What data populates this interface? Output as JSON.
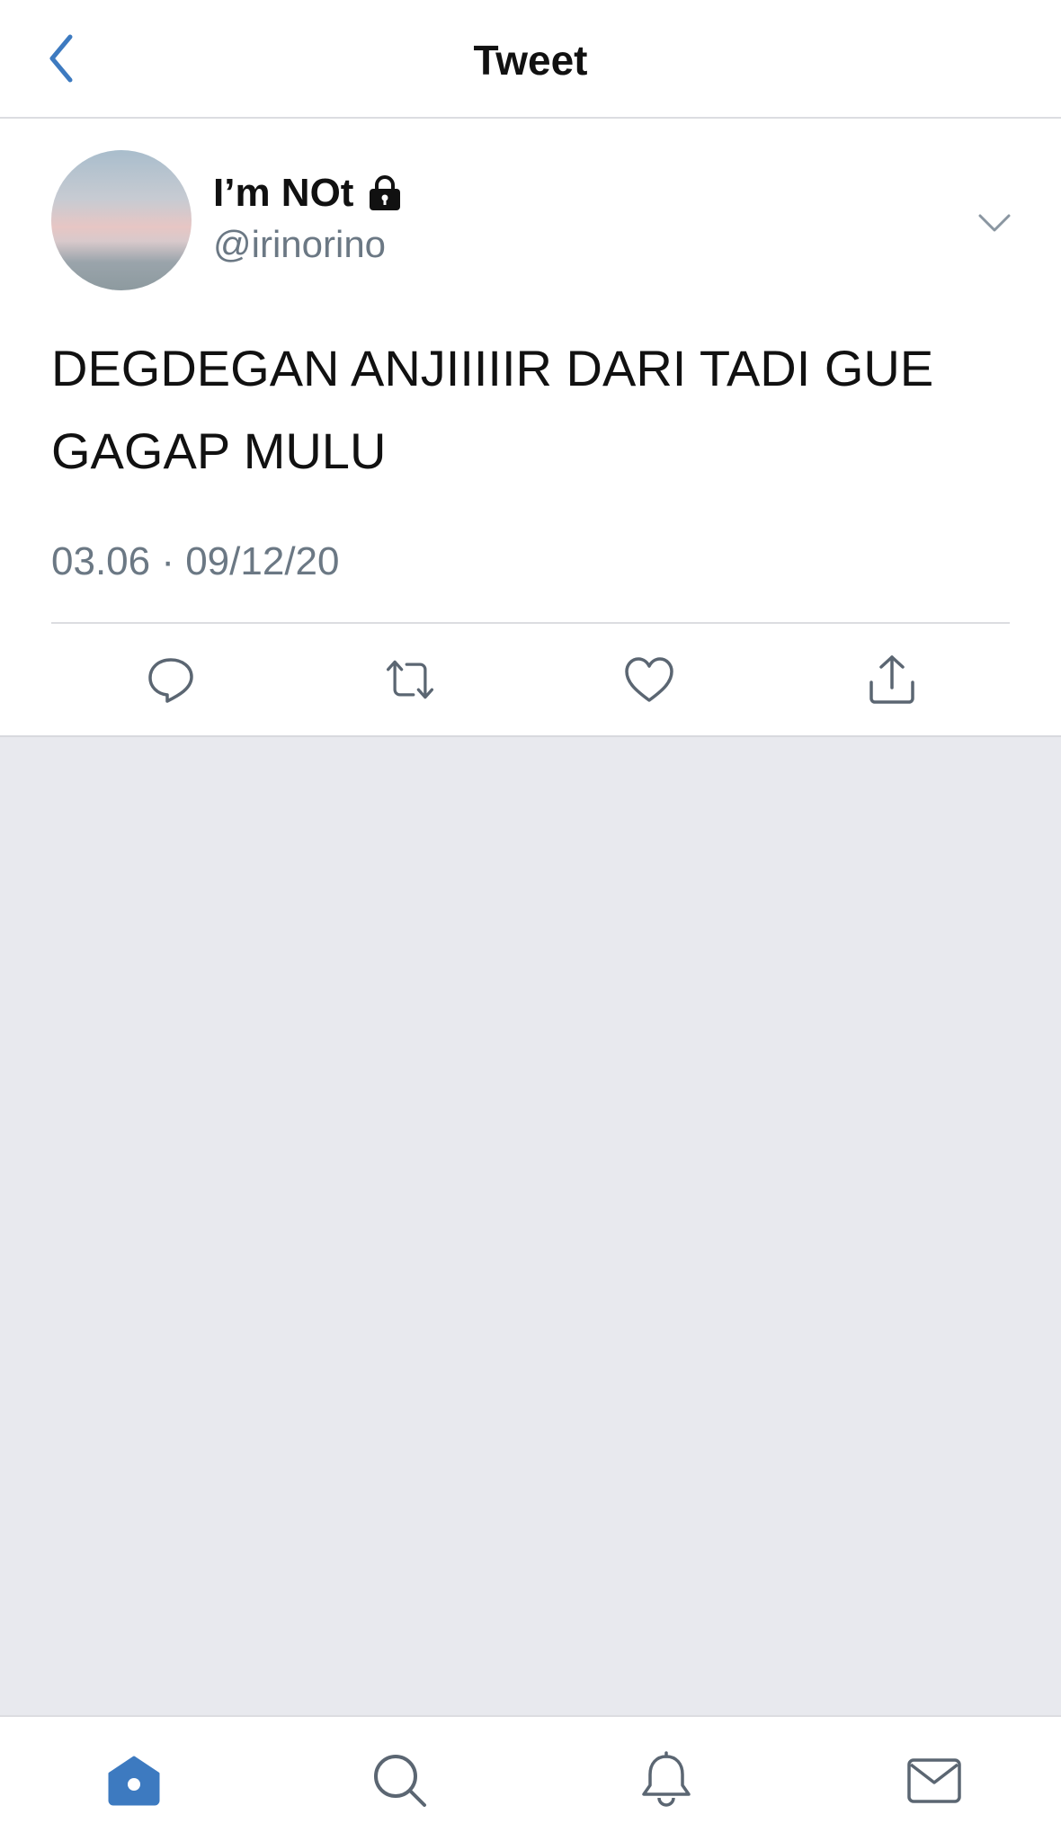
{
  "header": {
    "title": "Tweet",
    "back_icon": "chevron-left-icon"
  },
  "tweet": {
    "display_name": "I’m NOt",
    "locked_icon": "lock-icon",
    "handle": "@irinorino",
    "text": "DEGDEGAN ANJIIIIIR DARI TADI GUE GAGAP MULU",
    "timestamp": "03.06 · 09/12/20",
    "actions": [
      "reply-icon",
      "retweet-icon",
      "like-icon",
      "share-icon"
    ]
  },
  "tabbar": {
    "items": [
      "home-icon",
      "search-icon",
      "notifications-icon",
      "messages-icon"
    ],
    "active": "home-icon"
  },
  "colors": {
    "accent": "#3d7ac0",
    "secondary_text": "#6b7884",
    "background": "#e8e9ee"
  }
}
